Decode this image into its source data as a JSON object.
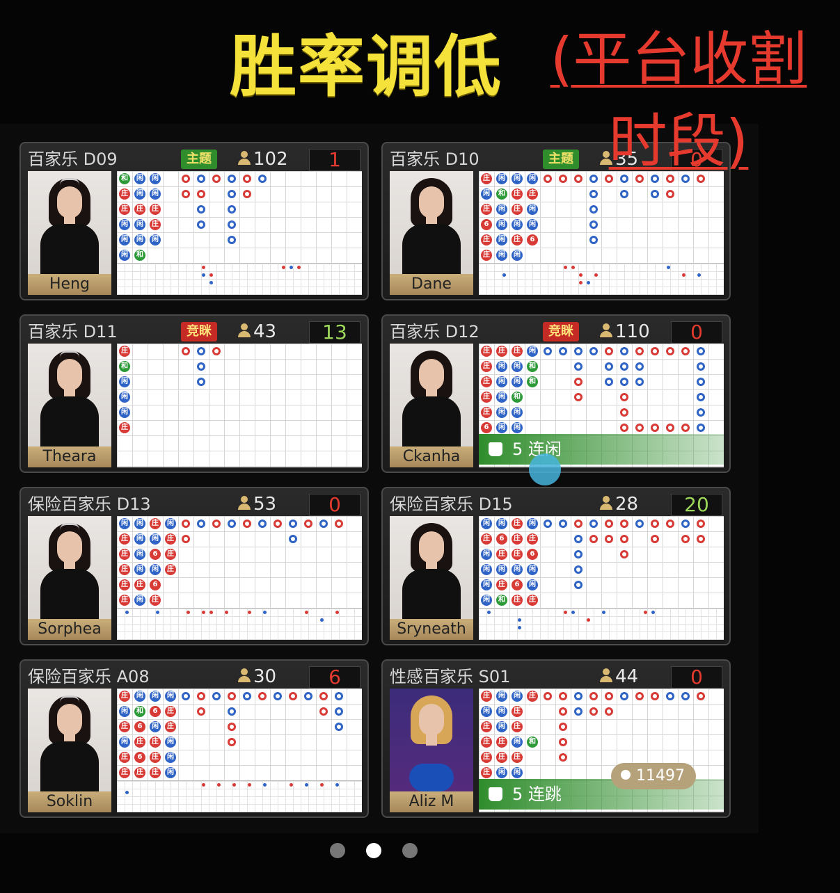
{
  "headline": "胜率调低",
  "overlay_note_line1": "(平台收割",
  "overlay_note_line2": "时段)",
  "badges": {
    "theme": "主题",
    "bid": "竞眯"
  },
  "tables": [
    {
      "name": "百家乐 D09",
      "badge": "theme",
      "players": "102",
      "score": "1",
      "score_color": "red",
      "dealer": "Heng"
    },
    {
      "name": "百家乐 D10",
      "badge": "theme",
      "players": "35",
      "score": "0",
      "score_color": "red",
      "dealer": "Dane"
    },
    {
      "name": "百家乐 D11",
      "badge": "bid",
      "players": "43",
      "score": "13",
      "score_color": "green",
      "dealer": "Theara"
    },
    {
      "name": "百家乐 D12",
      "badge": "bid",
      "players": "110",
      "score": "0",
      "score_color": "red",
      "dealer": "Ckanha",
      "streak": "5 连闲"
    },
    {
      "name": "保险百家乐 D13",
      "badge": "",
      "players": "53",
      "score": "0",
      "score_color": "red",
      "dealer": "Sorphea"
    },
    {
      "name": "保险百家乐 D15",
      "badge": "",
      "players": "28",
      "score": "20",
      "score_color": "green",
      "dealer": "Sryneath"
    },
    {
      "name": "保险百家乐 A08",
      "badge": "",
      "players": "30",
      "score": "6",
      "score_color": "red",
      "dealer": "Soklin"
    },
    {
      "name": "性感百家乐 S01",
      "badge": "",
      "players": "44",
      "score": "0",
      "score_color": "red",
      "dealer": "Aliz M",
      "streak": "5 连跳"
    }
  ],
  "online_count": "11497",
  "pager": {
    "pages": 3,
    "active": 2
  },
  "colors": {
    "banker": "#d83a36",
    "player": "#2f64c6",
    "tie": "#2d9a38",
    "headline": "#f4e13a",
    "note": "#e63a2e"
  }
}
